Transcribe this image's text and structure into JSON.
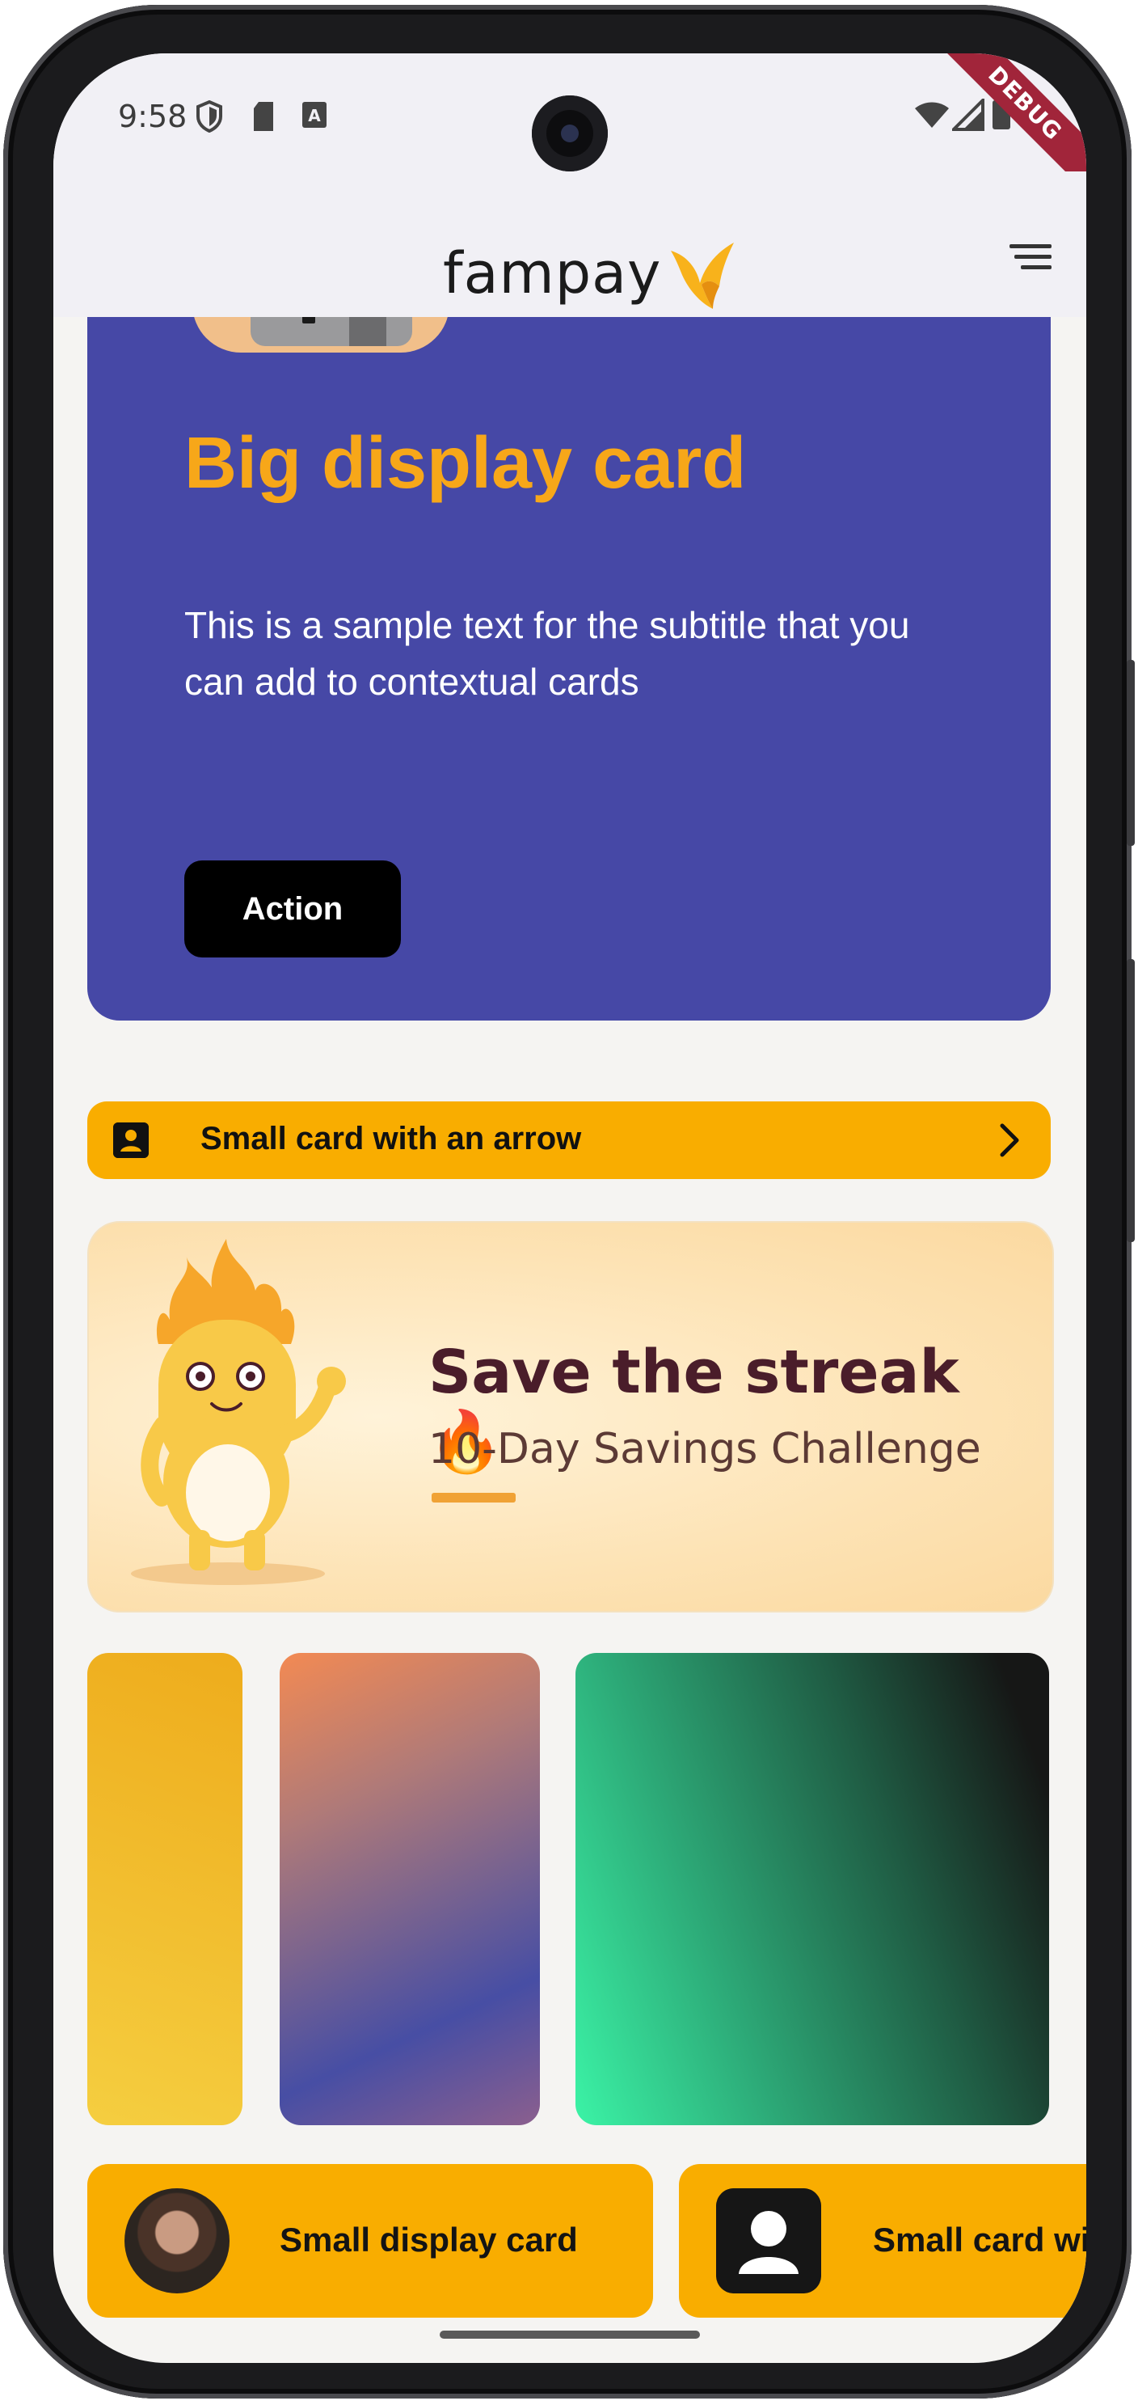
{
  "status_bar": {
    "time": "9:58",
    "debug_ribbon": "DEBUG",
    "icons": [
      "shield-icon",
      "sd-card-icon",
      "font-icon",
      "wifi-icon",
      "signal-icon",
      "battery-icon"
    ]
  },
  "app_bar": {
    "logo_text": "fampay",
    "menu_icon": "menu-icon",
    "background": "#f1f0f5"
  },
  "big_card": {
    "title": "Big display card",
    "subtitle": "This is a sample text for the subtitle that you can add to contextual cards",
    "action_label": "Action",
    "background": "#4648a6",
    "title_color": "#f7a719"
  },
  "arrow_card": {
    "label": "Small card with an arrow",
    "icon": "account-box-icon",
    "trailing_icon": "chevron-right-icon",
    "background": "#f9ad00"
  },
  "banner": {
    "title": "Save the streak 🔥",
    "subtitle": "10-Day Savings Challenge"
  },
  "gradient_cards": [
    {
      "name": "yellow-gradient"
    },
    {
      "name": "orange-purple-gradient"
    },
    {
      "name": "green-black-gradient"
    }
  ],
  "small_display_cards": [
    {
      "label": "Small display card",
      "icon": "avatar"
    },
    {
      "label": "Small card wi",
      "icon": "user-icon"
    }
  ]
}
